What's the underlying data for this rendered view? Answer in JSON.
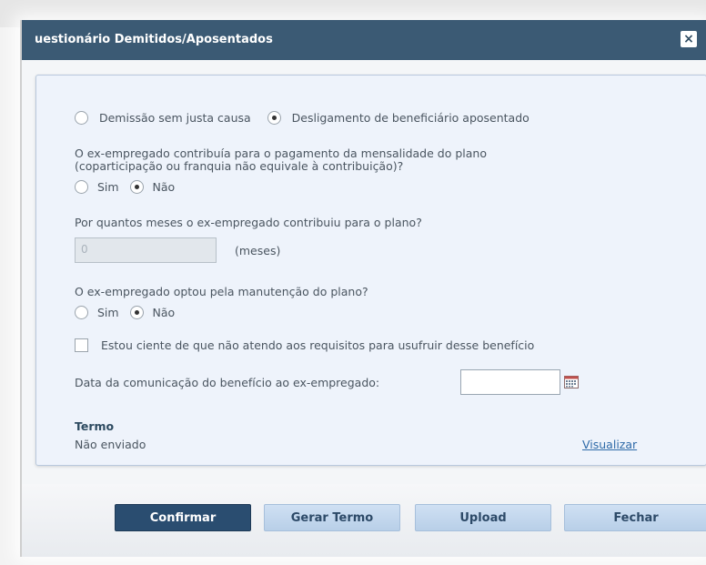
{
  "dialog": {
    "title": "uestionário Demitidos/Aposentados",
    "close": "×"
  },
  "options": {
    "reason_a": "Demissão sem justa causa",
    "reason_b": "Desligamento de beneficiário aposentado",
    "selected_reason": "reason_b"
  },
  "q1": {
    "text": "O ex-empregado contribuía para o pagamento da mensalidade do plano",
    "text2": "(coparticipação ou franquia não equivale à contribuição)?",
    "yes": "Sim",
    "no": "Não",
    "selected": "no"
  },
  "q2": {
    "text": "Por quantos meses o ex-empregado contribuiu para o plano?",
    "value": "0",
    "unit": "(meses)"
  },
  "q3": {
    "text": "O ex-empregado optou pela manutenção do plano?",
    "yes": "Sim",
    "no": "Não",
    "selected": "no"
  },
  "ack": {
    "text": "Estou ciente de que não atendo aos requisitos para usufruir desse benefício",
    "checked": false
  },
  "date": {
    "label": "Data da comunicação do benefício ao ex-empregado:",
    "value": ""
  },
  "termo": {
    "title": "Termo",
    "status": "Não enviado",
    "link": "Visualizar"
  },
  "buttons": {
    "confirm": "Confirmar",
    "generate": "Gerar Termo",
    "upload": "Upload",
    "close": "Fechar"
  }
}
